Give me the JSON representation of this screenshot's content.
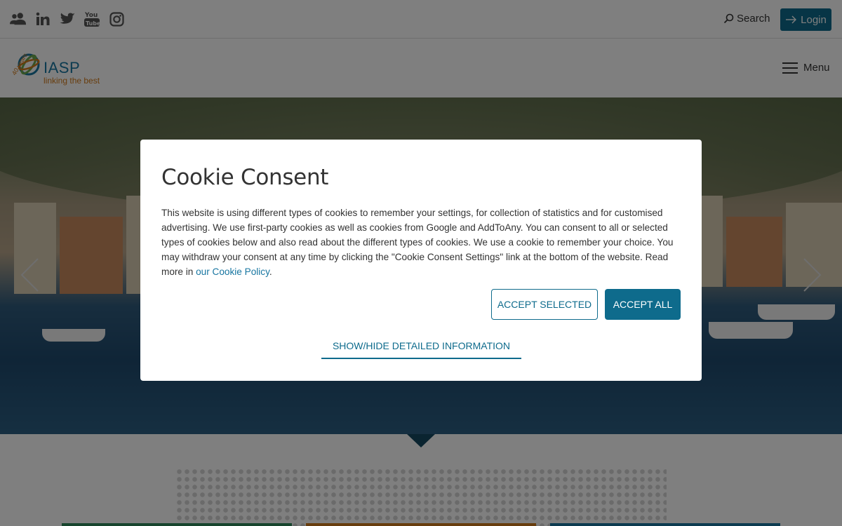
{
  "topbar": {
    "social": [
      {
        "name": "users-icon"
      },
      {
        "name": "linkedin-icon"
      },
      {
        "name": "twitter-icon"
      },
      {
        "name": "youtube-icon"
      },
      {
        "name": "instagram-icon"
      }
    ],
    "search_label": "Search",
    "login_label": "Login"
  },
  "header": {
    "logo_name": "IASP",
    "logo_tagline": "linking the best",
    "logo_years": "40 years",
    "menu_label": "Menu"
  },
  "cookie_modal": {
    "title": "Cookie Consent",
    "body_text": "This website is using different types of cookies to remember your settings, for collection of statistics and for customised advertising. We use first-party cookies as well as cookies from Google and AddToAny. You can consent to all or selected types of cookies below and also read about the different types of cookies. We use a cookie to remember your choice. You may withdraw your consent at any time by clicking the \"Cookie Consent Settings\" link at the bottom of the website. Read more in ",
    "policy_link": "our Cookie Policy",
    "body_end": ".",
    "accept_selected": "ACCEPT SELECTED",
    "accept_all": "ACCEPT ALL",
    "show_hide": "SHOW/HIDE DETAILED INFORMATION"
  },
  "colors": {
    "accent": "#0e6b8c",
    "link": "#1876a1",
    "logo_orange": "#d17a1b"
  }
}
